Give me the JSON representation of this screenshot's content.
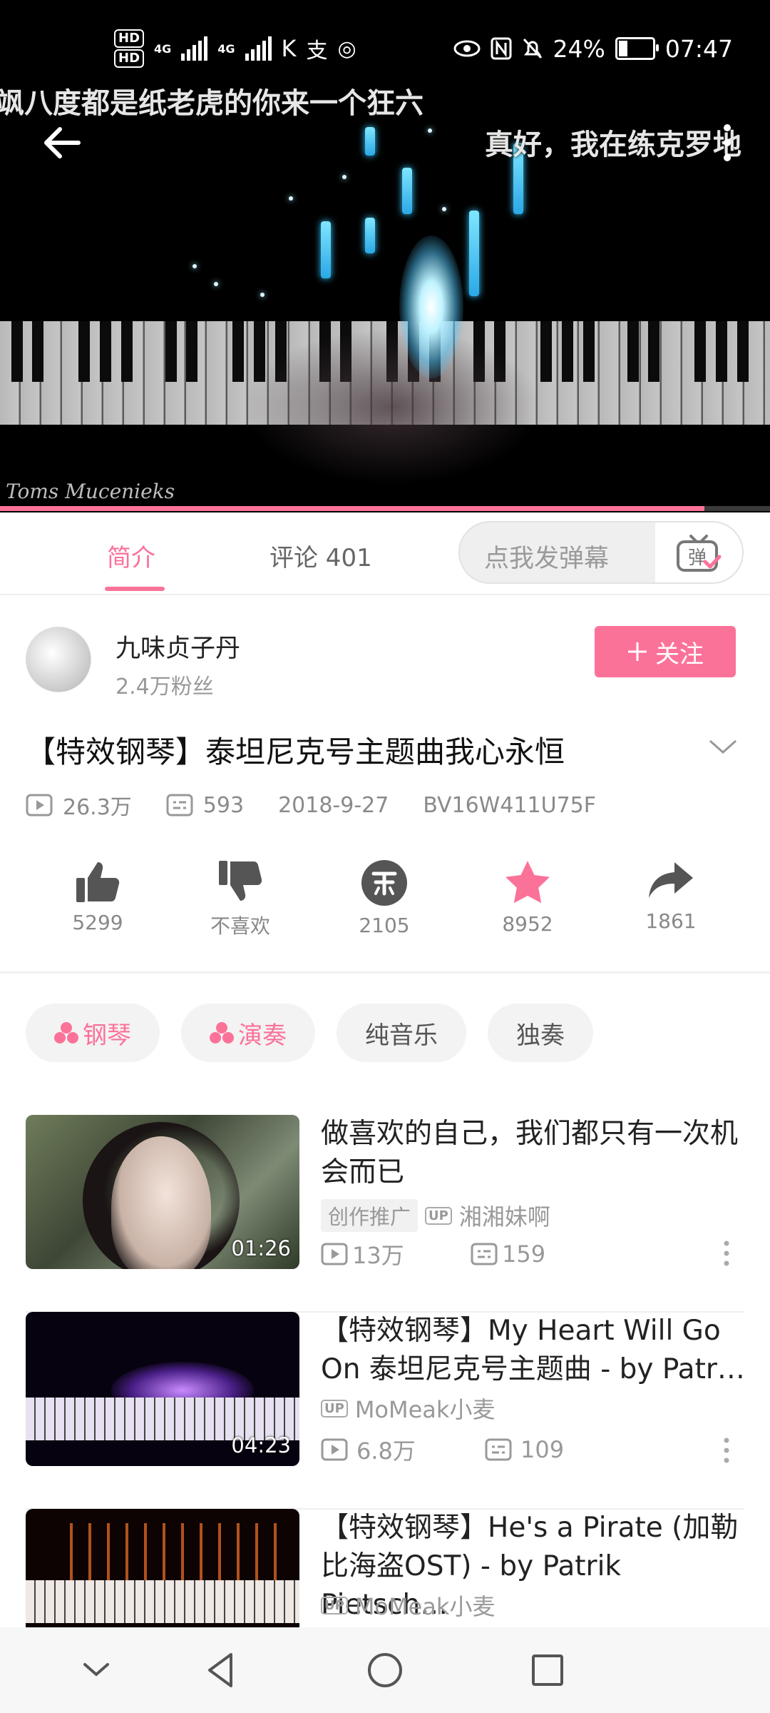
{
  "status_bar": {
    "chips": [
      "HD",
      "HD"
    ],
    "net_labels": [
      "4G",
      "4G"
    ],
    "battery": "24%",
    "battery_level": 0.24,
    "time": "07:47"
  },
  "video": {
    "danmaku": [
      "飒八度都是纸老虎的你来一个狂六",
      "真好，我在练克罗地"
    ],
    "watermark": "Toms Mucenieks",
    "progress": 0.915
  },
  "tabs": {
    "intro": "简介",
    "comments": "评论 401",
    "danmu_placeholder": "点我发弹幕",
    "danmu_icon_label": "弹"
  },
  "uploader": {
    "name": "九味贞子丹",
    "fans": "2.4万粉丝",
    "follow_label": "关注"
  },
  "video_info": {
    "title": "【特效钢琴】泰坦尼克号主题曲我心永恒",
    "views": "26.3万",
    "danmaku_count": "593",
    "date": "2018-9-27",
    "bvid": "BV16W411U75F"
  },
  "actions": {
    "like": "5299",
    "dislike": "不喜欢",
    "coin": "2105",
    "favorite": "8952",
    "share": "1861"
  },
  "tags": [
    "钢琴",
    "演奏",
    "纯音乐",
    "独奏"
  ],
  "recommendations": [
    {
      "title": "做喜欢的自己，我们都只有一次机会而已",
      "duration": "01:26",
      "promo": "创作推广",
      "up_badge": "UP",
      "uploader": "湘湘妹啊",
      "views": "13万",
      "danmaku": "159"
    },
    {
      "title": "【特效钢琴】My Heart Will Go On 泰坦尼克号主题曲 - by Patr…",
      "duration": "04:23",
      "up_badge": "UP",
      "uploader": "MoMeak小麦",
      "views": "6.8万",
      "danmaku": "109"
    },
    {
      "title": "【特效钢琴】He's a Pirate (加勒比海盗OST) - by Patrik Pietsch…",
      "up_badge": "UP",
      "uploader": "MoMeak小麦"
    }
  ],
  "colors": {
    "accent": "#fb7299",
    "muted": "#999999"
  }
}
